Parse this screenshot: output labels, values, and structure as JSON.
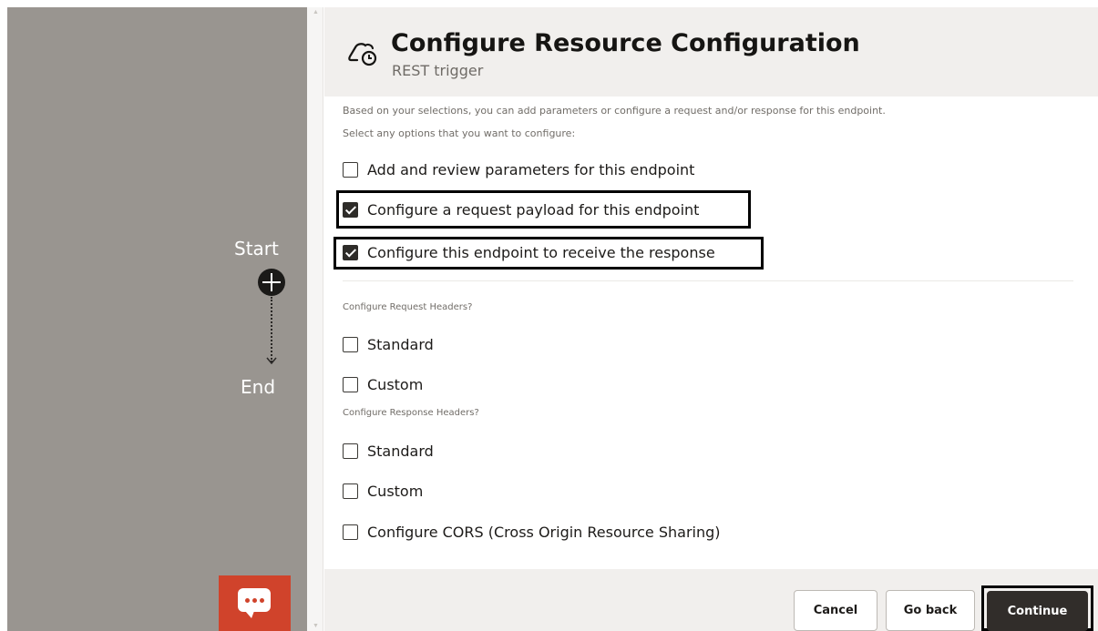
{
  "canvas": {
    "start_label": "Start",
    "end_label": "End",
    "chat_icon": "chat-bubble-icon"
  },
  "dialog": {
    "title": "Configure Resource Configuration",
    "subtitle": "REST trigger",
    "header_icon": "rest-trigger-icon",
    "intro_line_1": "Based on your selections, you can add parameters or configure a request and/or response for this endpoint.",
    "intro_line_2": "Select any options that you want to configure:",
    "options": [
      {
        "label": "Add and review parameters for this endpoint",
        "checked": false
      },
      {
        "label": "Configure a request payload for this endpoint",
        "checked": true
      },
      {
        "label": "Configure this endpoint to receive the response",
        "checked": true
      }
    ],
    "request_headers": {
      "label": "Configure Request Headers?",
      "options": [
        {
          "label": "Standard",
          "checked": false
        },
        {
          "label": "Custom",
          "checked": false
        }
      ]
    },
    "response_headers": {
      "label": "Configure Response Headers?",
      "options": [
        {
          "label": "Standard",
          "checked": false
        },
        {
          "label": "Custom",
          "checked": false
        }
      ]
    },
    "cors_option": {
      "label": "Configure CORS (Cross Origin Resource Sharing)",
      "checked": false
    },
    "footer": {
      "cancel_label": "Cancel",
      "go_back_label": "Go back",
      "continue_label": "Continue"
    }
  },
  "colors": {
    "canvas_bg": "#999590",
    "header_bg": "#f1efed",
    "chat_button": "#d0432b",
    "primary_button": "#312d2a"
  }
}
